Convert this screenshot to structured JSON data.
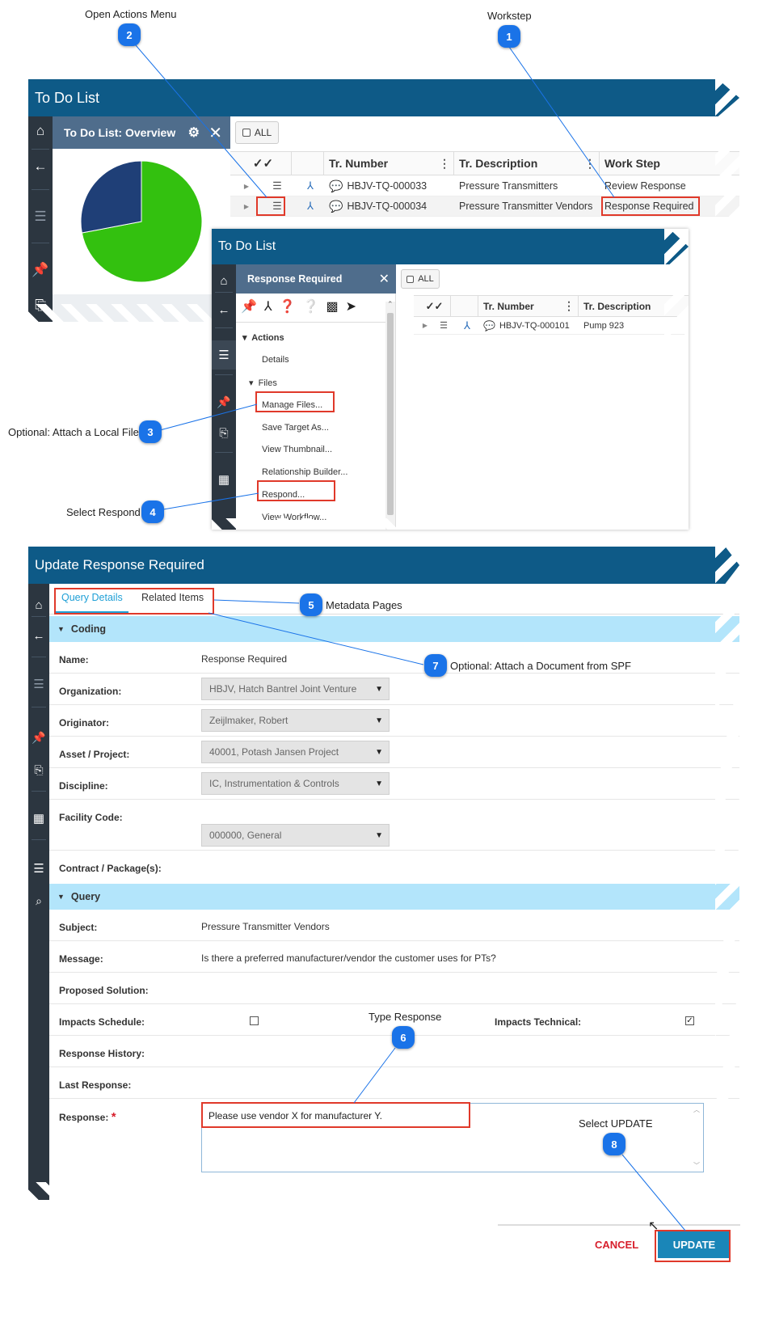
{
  "annotations": [
    {
      "n": "1",
      "label": "Workstep"
    },
    {
      "n": "2",
      "label": "Open Actions Menu"
    },
    {
      "n": "3",
      "label": "Optional: Attach a Local File"
    },
    {
      "n": "4",
      "label": "Select Respond"
    },
    {
      "n": "5",
      "label": "Metadata Pages"
    },
    {
      "n": "6",
      "label": "Type Response"
    },
    {
      "n": "7",
      "label": "Optional: Attach a Document from SPF"
    },
    {
      "n": "8",
      "label": "Select UPDATE"
    }
  ],
  "todo_panel": {
    "title": "To Do List",
    "overview_title": "To Do List: Overview",
    "all_button": "ALL",
    "pie": {
      "slices": [
        {
          "name": "green",
          "fraction": 0.72,
          "color": "#33c10f"
        },
        {
          "name": "navy",
          "fraction": 0.28,
          "color": "#1f3f77"
        }
      ]
    },
    "columns": [
      "",
      "",
      "Tr. Number",
      "Tr. Description",
      "Work Step"
    ],
    "rows": [
      {
        "number": "HBJV-TQ-000033",
        "description": "Pressure Transmitters",
        "workstep": "Review Response"
      },
      {
        "number": "HBJV-TQ-000034",
        "description": "Pressure Transmitter Vendors",
        "workstep": "Response Required"
      }
    ]
  },
  "actions_panel": {
    "title": "To Do List",
    "side_title": "Response Required",
    "all_button": "ALL",
    "columns": [
      "",
      "",
      "Tr. Number",
      "Tr. Description"
    ],
    "rows": [
      {
        "number": "HBJV-TQ-000101",
        "description": "Pump 923"
      }
    ],
    "tree": {
      "actions_label": "Actions",
      "details": "Details",
      "files_label": "Files",
      "files_items": [
        "Manage Files...",
        "Save Target As...",
        "View Thumbnail...",
        "Relationship Builder...",
        "Respond...",
        "View Workflow..."
      ]
    }
  },
  "update_panel": {
    "title": "Update Response Required",
    "tabs": [
      "Query Details",
      "Related Items"
    ],
    "sections": {
      "coding": "Coding",
      "query": "Query"
    },
    "fields": {
      "name": {
        "label": "Name:",
        "value": "Response Required"
      },
      "organization": {
        "label": "Organization:",
        "value": "HBJV, Hatch Bantrel Joint Venture"
      },
      "originator": {
        "label": "Originator:",
        "value": "Zeijlmaker, Robert"
      },
      "asset": {
        "label": "Asset / Project:",
        "value": "40001, Potash Jansen Project"
      },
      "discipline": {
        "label": "Discipline:",
        "value": "IC, Instrumentation & Controls"
      },
      "facility": {
        "label": "Facility Code:",
        "value": "000000, General"
      },
      "contract": {
        "label": "Contract / Package(s):",
        "value": ""
      },
      "subject": {
        "label": "Subject:",
        "value": "Pressure Transmitter Vendors"
      },
      "message": {
        "label": "Message:",
        "value": "Is there a preferred manufacturer/vendor the customer uses for PTs?"
      },
      "proposed": {
        "label": "Proposed Solution:",
        "value": ""
      },
      "impacts_schedule": {
        "label": "Impacts Schedule:",
        "checked": false
      },
      "impacts_technical": {
        "label": "Impacts Technical:",
        "checked": true
      },
      "history": {
        "label": "Response History:",
        "value": ""
      },
      "last_response": {
        "label": "Last Response:",
        "value": ""
      },
      "response": {
        "label": "Response:",
        "required_mark": "*",
        "value": "Please use vendor X for manufacturer Y."
      }
    },
    "footer": {
      "cancel": "CANCEL",
      "update": "UPDATE"
    }
  },
  "icons": {
    "check_mark": "✓",
    "chevron_down": "▾",
    "caret_right": "▸",
    "list": "☰",
    "close": "✕",
    "gear": "⚙"
  }
}
